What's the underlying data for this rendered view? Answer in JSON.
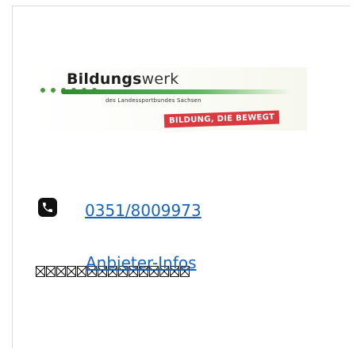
{
  "logo": {
    "title_bold": "Bildungs",
    "title_light": "werk",
    "subtitle": "des Landessportbundes Sachsen",
    "badge": "BILDUNG, DIE BEWEGT"
  },
  "contact": {
    "phone_icon": "phone-icon",
    "phone": "0351/8009973"
  },
  "link": {
    "label": "Anbieter-Infos"
  },
  "colors": {
    "link": "#1565c0",
    "brand_green": "#4a9a3a",
    "badge_red": "#d9393f"
  }
}
